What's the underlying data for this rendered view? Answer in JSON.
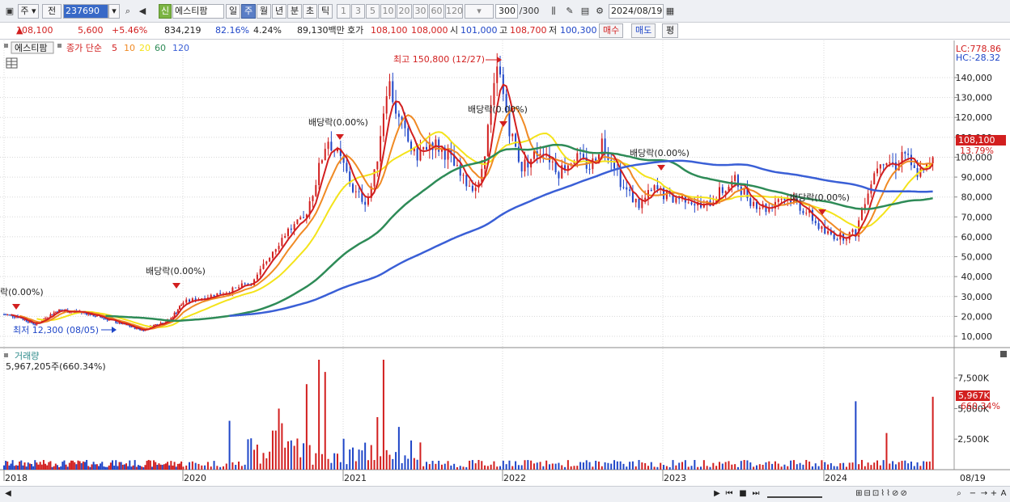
{
  "toolbar": {
    "market": "주",
    "prev_label": "전",
    "code": "237690",
    "badge": "신",
    "stock_name": "에스티팜",
    "periods": [
      "일",
      "주",
      "월",
      "년",
      "분",
      "초",
      "틱"
    ],
    "selected_period": "주",
    "intervals": [
      "1",
      "3",
      "5",
      "10",
      "20",
      "30",
      "60",
      "120"
    ],
    "count": "300",
    "count_total": "/300",
    "date": "2024/08/19"
  },
  "infobar": {
    "price": "108,100",
    "change": "5,600",
    "change_pct": "+5.46%",
    "volume": "834,219",
    "vol_ratio": "82.16%",
    "turnover": "4.24%",
    "amount": "89,130백만",
    "quote_label": "호가",
    "ask": "108,100",
    "bid": "108,000",
    "open_label": "시",
    "open": "101,000",
    "high_label": "고",
    "high": "108,700",
    "low_label": "저",
    "low": "100,300",
    "buy": "매수",
    "sell": "매도",
    "eval": "평"
  },
  "price_panel": {
    "name_box": "에스티팜",
    "legend_main": "종가 단순",
    "ma_periods": [
      "5",
      "10",
      "20",
      "60",
      "120"
    ],
    "lc_label": "LC:778.86",
    "hc_label": "HC:-28.32",
    "current_price": "108,100",
    "current_pct": "13.79%",
    "y_ticks": [
      "140,000",
      "130,000",
      "120,000",
      "110,000",
      "100,000",
      "90,000",
      "80,000",
      "70,000",
      "60,000",
      "50,000",
      "40,000",
      "30,000",
      "20,000",
      "10,000"
    ],
    "annotations": {
      "high": "최고 150,800 (12/27)",
      "low": "최저 12,300 (08/05)",
      "div1": "락(0.00%)",
      "div2": "배당락(0.00%)",
      "div3": "배당락(0.00%)",
      "div4": "배당락(0.00%)",
      "div5": "배당락(0.00%)",
      "div6": "배당락(0.00%)"
    }
  },
  "volume_panel": {
    "title": "거래량",
    "value": "5,967,205주(660.34%)",
    "y_ticks": [
      "7,500K",
      "5,000K",
      "2,500K"
    ],
    "current": "5,967K",
    "current_pct": "660.34%"
  },
  "x_axis": {
    "labels": [
      "2018",
      "2020",
      "2021",
      "2022",
      "2023",
      "2024"
    ],
    "right_label": "08/19"
  },
  "colors": {
    "up": "#d21f1f",
    "down": "#1f46c8",
    "ma5": "#d21f1f",
    "ma10": "#f08a24",
    "ma20": "#f4e31a",
    "ma60": "#2e8b57",
    "ma120": "#3a5fd6"
  },
  "chart_data": {
    "type": "candlestick",
    "title": "에스티팜",
    "y_range": [
      5000,
      150000
    ],
    "series": [
      {
        "name": "5",
        "values_approx": [
          20000,
          22000,
          16000,
          18000,
          28000,
          35000,
          60000,
          105000,
          80000,
          140000,
          100000,
          145000,
          95000,
          88000,
          85000,
          80000,
          75000,
          65000,
          60000,
          95000,
          100000
        ]
      },
      {
        "name": "60",
        "values_approx": [
          20000,
          22000,
          25000,
          35000,
          55000,
          70000,
          95000,
          110000,
          103000,
          95000,
          87000,
          82000,
          78000,
          78000
        ]
      },
      {
        "name": "120",
        "values_approx": [
          40000,
          60000,
          78000,
          90000,
          97000,
          95000,
          88000,
          83000,
          82000
        ]
      }
    ],
    "volume_max": 9000000
  }
}
